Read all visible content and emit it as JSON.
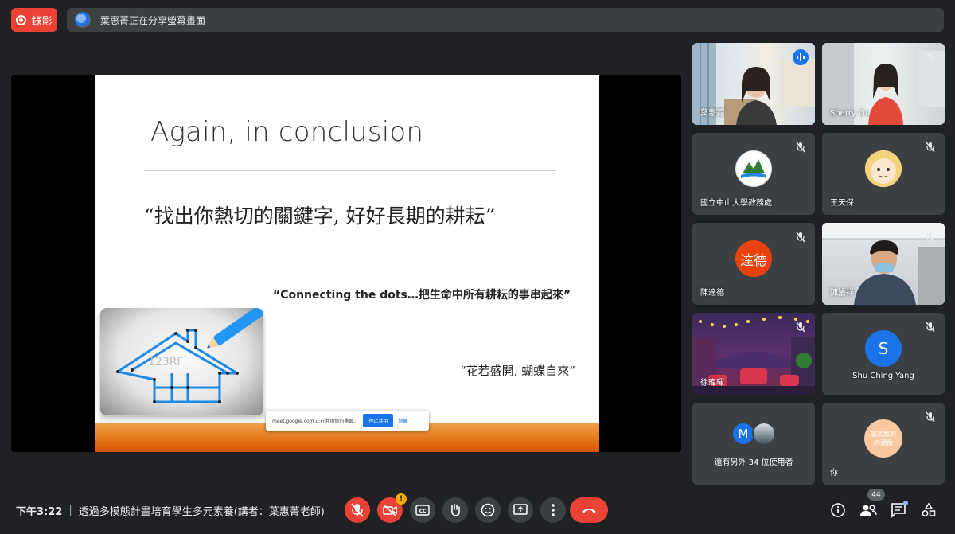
{
  "top_bar": {
    "record_label": "錄影",
    "share_banner_text": "葉惠菁正在分享螢幕畫面"
  },
  "slide": {
    "title": "Again, in conclusion",
    "quote1": "“找出你熱切的關鍵字, 好好長期的耕耘”",
    "quote2": "“Connecting the dots…把生命中所有耕耘的事串起來”",
    "quote3": "“花若盛開, 蝴蝶自來”",
    "image_watermark": "123RF"
  },
  "share_popup": {
    "text": "meet.google.com 正在共用你的畫面。",
    "stop_label": "停止共用",
    "hide_label": "隱藏"
  },
  "participants": [
    {
      "name": "葉惠菁",
      "speaking": true
    },
    {
      "name": "Sherry Ou",
      "muted": true
    },
    {
      "name": "國立中山大學教務處",
      "muted": true
    },
    {
      "name": "王天保",
      "muted": true
    },
    {
      "name": "陳達德",
      "avatar_text": "達德",
      "muted": true
    },
    {
      "name": "陳濬祥",
      "muted": true
    },
    {
      "name": "徐瑋暉",
      "muted": true
    },
    {
      "name": "Shu Ching Yang",
      "avatar_text": "S",
      "muted": true
    },
    {
      "name": "你",
      "avatar_text": "翁美賢的\n的頭像",
      "muted": true
    }
  ],
  "more_tile": {
    "avatar_text": "M",
    "label": "還有另外 34 位使用者"
  },
  "bottom_bar": {
    "time": "下午3:22",
    "separator": "|",
    "meeting_title": "透過多模態計畫培育學生多元素養(講者：葉惠菁老師)",
    "camera_badge": "!",
    "participant_count": "44"
  },
  "colors": {
    "background": "#202124",
    "tile": "#3c4043",
    "accent": "#1a73e8",
    "danger": "#ea4335",
    "slide_bar": "#e67e22"
  }
}
